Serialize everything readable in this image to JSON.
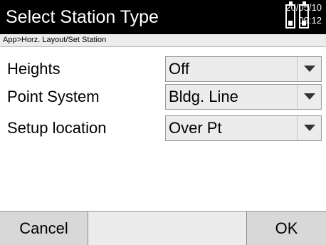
{
  "header": {
    "title": "Select Station Type",
    "date": "20/05/10",
    "time": "09:12",
    "battery_icons": [
      "battery-icon",
      "battery-icon"
    ]
  },
  "breadcrumb": "App>Horz. Layout/Set Station",
  "fields": [
    {
      "label": "Heights",
      "value": "Off"
    },
    {
      "label": "Point System",
      "value": "Bldg. Line"
    },
    {
      "label": "Setup location",
      "value": "Over Pt"
    }
  ],
  "footer": {
    "cancel_label": "Cancel",
    "ok_label": "OK"
  },
  "colors": {
    "title_bar": "#000000",
    "field_bg": "#ececec",
    "button_bg": "#d8d8d8",
    "arrow": "#333333"
  }
}
